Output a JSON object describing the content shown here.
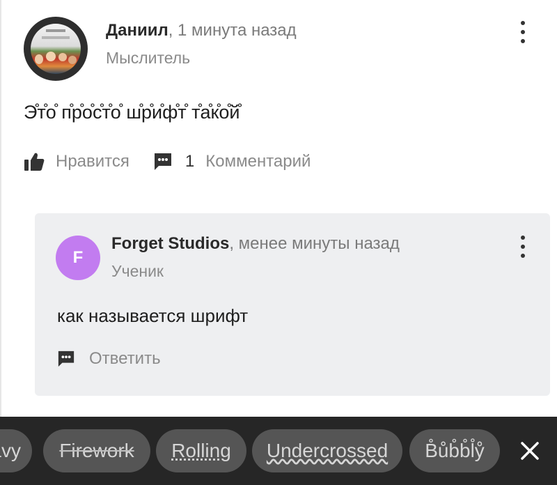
{
  "post": {
    "author": "Даниил",
    "time": ", 1 минута назад",
    "rank": "Мыслитель",
    "body": "Э̊т̊о̊ п̊р̊о̊с̊т̊о̊ ш̊р̊и̊ф̊т̊ т̊а̊к̊о̊й̊",
    "like_label": "Нравится",
    "comment_count": "1",
    "comment_label": "Комментарий"
  },
  "reply": {
    "avatar_letter": "F",
    "avatar_color": "#c27cf0",
    "author": "Forget Studios",
    "time": ", менее минуты назад",
    "rank": "Ученик",
    "body": "как называется шрифт",
    "reply_label": "Ответить"
  },
  "font_bar": {
    "chips": [
      "avy",
      "Firework",
      "Rolling",
      "Undercrossed",
      "B̊ůb̊b̊l̊ẙ"
    ],
    "close_icon": "close-icon"
  },
  "icons": {
    "like": "thumbs-up-icon",
    "comment": "comment-icon",
    "more": "more-vertical-icon"
  }
}
